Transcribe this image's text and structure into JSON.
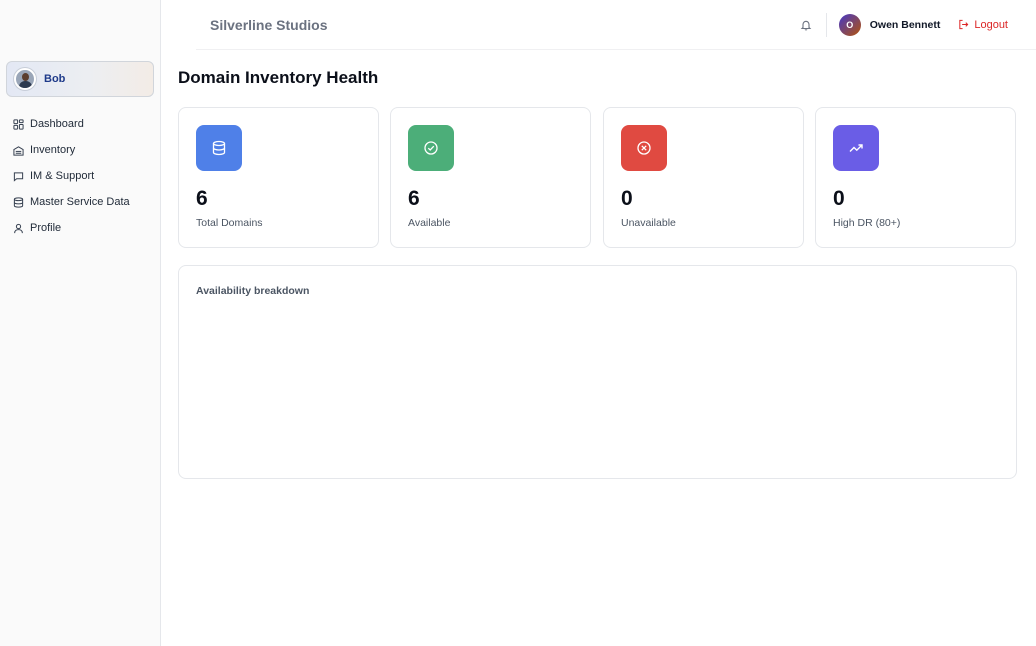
{
  "header": {
    "brand": "Silverline Studios",
    "user_initial": "O",
    "user_name": "Owen Bennett",
    "logout_label": "Logout"
  },
  "sidebar": {
    "user_name": "Bob",
    "items": [
      {
        "label": "Dashboard",
        "icon": "dashboard-grid-icon"
      },
      {
        "label": "Inventory",
        "icon": "inventory-icon"
      },
      {
        "label": "IM & Support",
        "icon": "chat-icon"
      },
      {
        "label": "Master Service Data",
        "icon": "database-icon"
      },
      {
        "label": "Profile",
        "icon": "user-icon"
      }
    ]
  },
  "main": {
    "title": "Domain Inventory Health",
    "stats": [
      {
        "value": "6",
        "label": "Total Domains",
        "icon": "database-icon",
        "color": "#4f80e8"
      },
      {
        "value": "6",
        "label": "Available",
        "icon": "check-circle-icon",
        "color": "#4cae79"
      },
      {
        "value": "0",
        "label": "Unavailable",
        "icon": "x-circle-icon",
        "color": "#e04a41"
      },
      {
        "value": "0",
        "label": "High DR (80+)",
        "icon": "trending-up-icon",
        "color": "#6a5de6"
      }
    ],
    "breakdown_title": "Availability breakdown"
  },
  "colors": {
    "brand_text": "#6b7280",
    "logout": "#dc2626",
    "sidebar_bg": "#fafafa",
    "active_chip_text": "#1e3a8a"
  }
}
